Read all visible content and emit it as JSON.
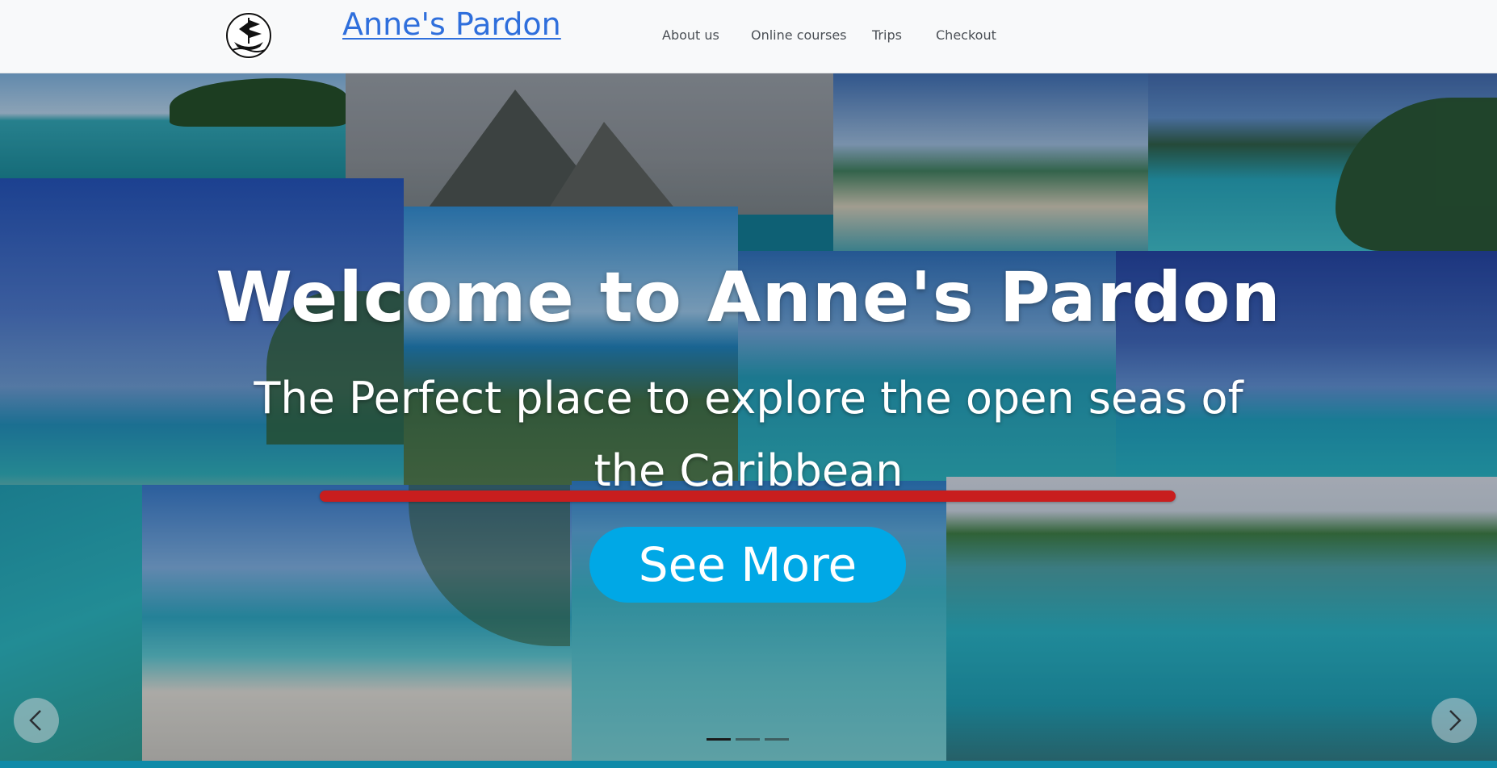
{
  "navbar": {
    "brand": "Anne's Pardon",
    "links": [
      "About us",
      "Online courses",
      "Trips",
      "Checkout"
    ]
  },
  "hero": {
    "title": "Welcome to Anne's Pardon",
    "subtitle": "The Perfect place to explore the open seas of the Caribbean",
    "cta_label": "See More",
    "carousel": {
      "slide_count": 3,
      "active_slide": 1
    }
  },
  "colors": {
    "brand_link": "#2f6fdc",
    "cta": "#00a8e6",
    "rule": "#c81e1e",
    "navbar_bg": "#f8f9fa"
  },
  "icons": {
    "logo": "pirate-ship-icon",
    "prev": "chevron-left-icon",
    "next": "chevron-right-icon"
  }
}
